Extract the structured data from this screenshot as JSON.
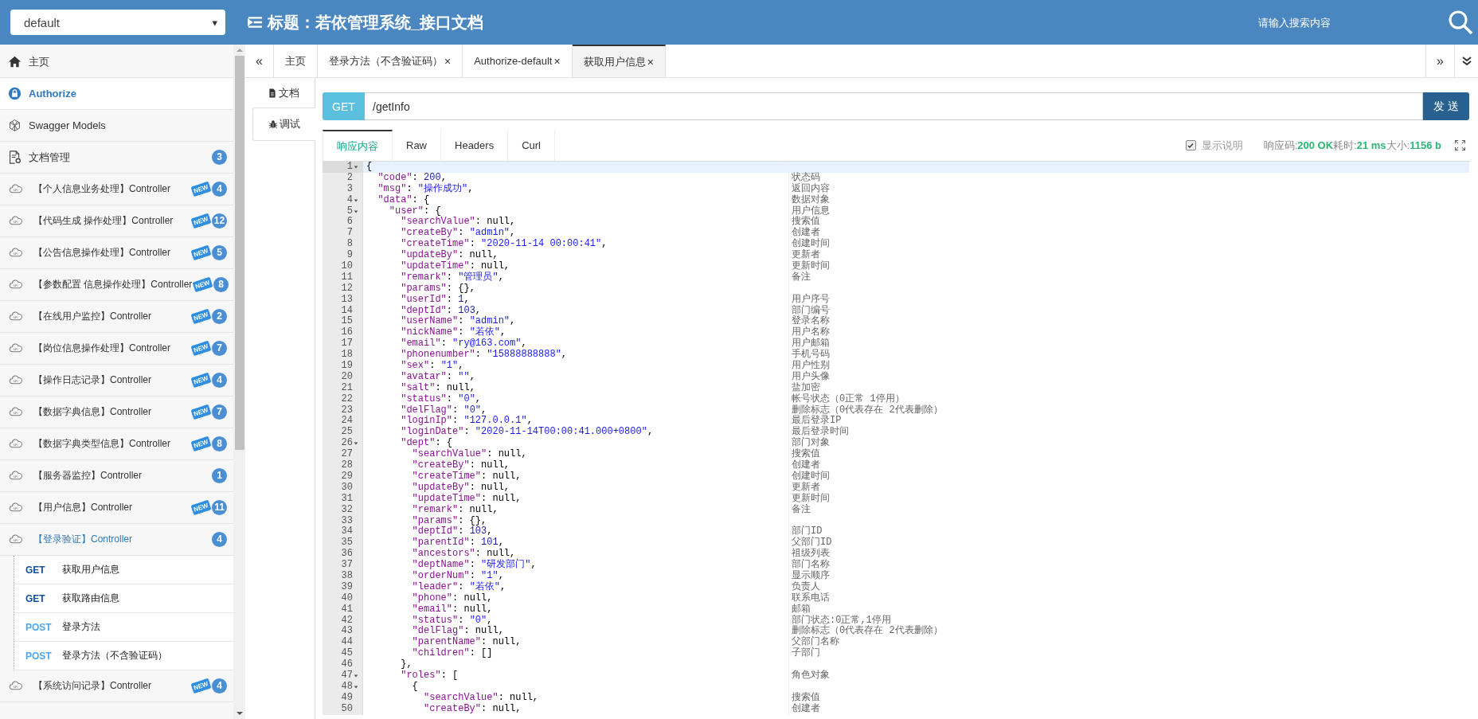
{
  "header": {
    "select": {
      "value": "default",
      "caret": "▾"
    },
    "title": "标题：若依管理系统_接口文档",
    "search": {
      "placeholder": "请输入搜索内容"
    }
  },
  "sidebar": {
    "items": [
      {
        "kind": "home",
        "label": "主页",
        "selected": false
      },
      {
        "kind": "authorize",
        "label": "Authorize",
        "selected": true
      },
      {
        "kind": "models",
        "label": "Swagger Models",
        "selected": false
      },
      {
        "kind": "docs",
        "label": "文档管理",
        "count": "3",
        "selected": false
      },
      {
        "kind": "controller",
        "label": "【个人信息业务处理】Controller",
        "new_tag": "NEW",
        "count": "4",
        "expanded": false,
        "selected": false
      },
      {
        "kind": "controller",
        "label": "【代码生成 操作处理】Controller",
        "new_tag": "NEW",
        "count": "12",
        "expanded": false,
        "selected": false
      },
      {
        "kind": "controller",
        "label": "【公告信息操作处理】Controller",
        "new_tag": "NEW",
        "count": "5",
        "expanded": false,
        "selected": false
      },
      {
        "kind": "controller",
        "label": "【参数配置 信息操作处理】Controller",
        "new_tag": "NEW",
        "count": "8",
        "expanded": false,
        "selected": false
      },
      {
        "kind": "controller",
        "label": "【在线用户监控】Controller",
        "new_tag": "NEW",
        "count": "2",
        "expanded": false,
        "selected": false
      },
      {
        "kind": "controller",
        "label": "【岗位信息操作处理】Controller",
        "new_tag": "NEW",
        "count": "7",
        "expanded": false,
        "selected": false
      },
      {
        "kind": "controller",
        "label": "【操作日志记录】Controller",
        "new_tag": "NEW",
        "count": "4",
        "expanded": false,
        "selected": false
      },
      {
        "kind": "controller",
        "label": "【数据字典信息】Controller",
        "new_tag": "NEW",
        "count": "7",
        "expanded": false,
        "selected": false
      },
      {
        "kind": "controller",
        "label": "【数据字典类型信息】Controller",
        "new_tag": "NEW",
        "count": "8",
        "expanded": false,
        "selected": false
      },
      {
        "kind": "controller",
        "label": "【服务器监控】Controller",
        "count": "1",
        "expanded": false,
        "selected": false
      },
      {
        "kind": "controller",
        "label": "【用户信息】Controller",
        "new_tag": "NEW",
        "count": "11",
        "expanded": false,
        "selected": false
      },
      {
        "kind": "controller",
        "label": "【登录验证】Controller",
        "count": "4",
        "expanded": true,
        "selected": false,
        "children": [
          {
            "kind": "get",
            "method": "GET",
            "label": "获取用户信息"
          },
          {
            "kind": "get",
            "method": "GET",
            "label": "获取路由信息"
          },
          {
            "kind": "post",
            "method": "POST",
            "label": "登录方法"
          },
          {
            "kind": "post",
            "method": "POST",
            "label": "登录方法（不含验证码）"
          }
        ]
      },
      {
        "kind": "controller",
        "label": "【系统访问记录】Controller",
        "new_tag": "NEW",
        "count": "4",
        "expanded": false,
        "selected": false
      }
    ]
  },
  "tabs": {
    "prev": "«",
    "next": "»",
    "items": [
      {
        "label": "主页",
        "selected": false
      },
      {
        "label": "登录方法（不含验证码）",
        "close": "×",
        "selected": false
      },
      {
        "label": "Authorize-default",
        "close": "×",
        "selected": false
      },
      {
        "label": "获取用户信息",
        "close": "×",
        "selected": true
      }
    ]
  },
  "side_tabs": [
    {
      "kind": "doc",
      "label": "文档",
      "selected": false
    },
    {
      "kind": "debug",
      "label": "调试",
      "selected": true
    }
  ],
  "request": {
    "method": "GET",
    "url": "/getInfo",
    "send": "发 送"
  },
  "response": {
    "tabs": [
      {
        "label": "响应内容",
        "selected": true
      },
      {
        "label": "Raw",
        "selected": false
      },
      {
        "label": "Headers",
        "selected": false
      },
      {
        "label": "Curl",
        "selected": false
      }
    ],
    "show_notes": {
      "label": "显示说明",
      "checked": true
    },
    "status": [
      {
        "label": "响应码:",
        "value": "200 OK"
      },
      {
        "label": "耗时:",
        "value": "21 ms"
      },
      {
        "label": "大小:",
        "value": "1156 b"
      }
    ],
    "lines": [
      {
        "n": "1",
        "fold": true,
        "current": true,
        "code": [
          {
            "kind": "plain",
            "text": "{"
          }
        ]
      },
      {
        "n": "2",
        "fold": false,
        "current": false,
        "code": [
          {
            "kind": "key",
            "text": "  \"code\""
          },
          {
            "kind": "plain",
            "text": ": "
          },
          {
            "kind": "number",
            "text": "200"
          },
          {
            "kind": "plain",
            "text": ","
          }
        ],
        "note": "状态码"
      },
      {
        "n": "3",
        "fold": false,
        "current": false,
        "code": [
          {
            "kind": "key",
            "text": "  \"msg\""
          },
          {
            "kind": "plain",
            "text": ": "
          },
          {
            "kind": "string",
            "text": "\"操作成功\""
          },
          {
            "kind": "plain",
            "text": ","
          }
        ],
        "note": "返回内容"
      },
      {
        "n": "4",
        "fold": true,
        "current": false,
        "code": [
          {
            "kind": "key",
            "text": "  \"data\""
          },
          {
            "kind": "plain",
            "text": ": {"
          }
        ],
        "note": "数据对象"
      },
      {
        "n": "5",
        "fold": true,
        "current": false,
        "code": [
          {
            "kind": "key",
            "text": "    \"user\""
          },
          {
            "kind": "plain",
            "text": ": {"
          }
        ],
        "note": "用户信息"
      },
      {
        "n": "6",
        "fold": false,
        "current": false,
        "code": [
          {
            "kind": "key",
            "text": "      \"searchValue\""
          },
          {
            "kind": "plain",
            "text": ": null,"
          }
        ],
        "note": "搜索值"
      },
      {
        "n": "7",
        "fold": false,
        "current": false,
        "code": [
          {
            "kind": "key",
            "text": "      \"createBy\""
          },
          {
            "kind": "plain",
            "text": ": "
          },
          {
            "kind": "string",
            "text": "\"admin\""
          },
          {
            "kind": "plain",
            "text": ","
          }
        ],
        "note": "创建者"
      },
      {
        "n": "8",
        "fold": false,
        "current": false,
        "code": [
          {
            "kind": "key",
            "text": "      \"createTime\""
          },
          {
            "kind": "plain",
            "text": ": "
          },
          {
            "kind": "string",
            "text": "\"2020-11-14 00:00:41\""
          },
          {
            "kind": "plain",
            "text": ","
          }
        ],
        "note": "创建时间"
      },
      {
        "n": "9",
        "fold": false,
        "current": false,
        "code": [
          {
            "kind": "key",
            "text": "      \"updateBy\""
          },
          {
            "kind": "plain",
            "text": ": null,"
          }
        ],
        "note": "更新者"
      },
      {
        "n": "10",
        "fold": false,
        "current": false,
        "code": [
          {
            "kind": "key",
            "text": "      \"updateTime\""
          },
          {
            "kind": "plain",
            "text": ": null,"
          }
        ],
        "note": "更新时间"
      },
      {
        "n": "11",
        "fold": false,
        "current": false,
        "code": [
          {
            "kind": "key",
            "text": "      \"remark\""
          },
          {
            "kind": "plain",
            "text": ": "
          },
          {
            "kind": "string",
            "text": "\"管理员\""
          },
          {
            "kind": "plain",
            "text": ","
          }
        ],
        "note": "备注"
      },
      {
        "n": "12",
        "fold": false,
        "current": false,
        "code": [
          {
            "kind": "key",
            "text": "      \"params\""
          },
          {
            "kind": "plain",
            "text": ": {},"
          }
        ]
      },
      {
        "n": "13",
        "fold": false,
        "current": false,
        "code": [
          {
            "kind": "key",
            "text": "      \"userId\""
          },
          {
            "kind": "plain",
            "text": ": "
          },
          {
            "kind": "number",
            "text": "1"
          },
          {
            "kind": "plain",
            "text": ","
          }
        ],
        "note": "用户序号"
      },
      {
        "n": "14",
        "fold": false,
        "current": false,
        "code": [
          {
            "kind": "key",
            "text": "      \"deptId\""
          },
          {
            "kind": "plain",
            "text": ": "
          },
          {
            "kind": "number",
            "text": "103"
          },
          {
            "kind": "plain",
            "text": ","
          }
        ],
        "note": "部门编号"
      },
      {
        "n": "15",
        "fold": false,
        "current": false,
        "code": [
          {
            "kind": "key",
            "text": "      \"userName\""
          },
          {
            "kind": "plain",
            "text": ": "
          },
          {
            "kind": "string",
            "text": "\"admin\""
          },
          {
            "kind": "plain",
            "text": ","
          }
        ],
        "note": "登录名称"
      },
      {
        "n": "16",
        "fold": false,
        "current": false,
        "code": [
          {
            "kind": "key",
            "text": "      \"nickName\""
          },
          {
            "kind": "plain",
            "text": ": "
          },
          {
            "kind": "string",
            "text": "\"若依\""
          },
          {
            "kind": "plain",
            "text": ","
          }
        ],
        "note": "用户名称"
      },
      {
        "n": "17",
        "fold": false,
        "current": false,
        "code": [
          {
            "kind": "key",
            "text": "      \"email\""
          },
          {
            "kind": "plain",
            "text": ": "
          },
          {
            "kind": "string",
            "text": "\"ry@163.com\""
          },
          {
            "kind": "plain",
            "text": ","
          }
        ],
        "note": "用户邮箱"
      },
      {
        "n": "18",
        "fold": false,
        "current": false,
        "code": [
          {
            "kind": "key",
            "text": "      \"phonenumber\""
          },
          {
            "kind": "plain",
            "text": ": "
          },
          {
            "kind": "string",
            "text": "\"15888888888\""
          },
          {
            "kind": "plain",
            "text": ","
          }
        ],
        "note": "手机号码"
      },
      {
        "n": "19",
        "fold": false,
        "current": false,
        "code": [
          {
            "kind": "key",
            "text": "      \"sex\""
          },
          {
            "kind": "plain",
            "text": ": "
          },
          {
            "kind": "string",
            "text": "\"1\""
          },
          {
            "kind": "plain",
            "text": ","
          }
        ],
        "note": "用户性别"
      },
      {
        "n": "20",
        "fold": false,
        "current": false,
        "code": [
          {
            "kind": "key",
            "text": "      \"avatar\""
          },
          {
            "kind": "plain",
            "text": ": "
          },
          {
            "kind": "string",
            "text": "\"\""
          },
          {
            "kind": "plain",
            "text": ","
          }
        ],
        "note": "用户头像"
      },
      {
        "n": "21",
        "fold": false,
        "current": false,
        "code": [
          {
            "kind": "key",
            "text": "      \"salt\""
          },
          {
            "kind": "plain",
            "text": ": null,"
          }
        ],
        "note": "盐加密"
      },
      {
        "n": "22",
        "fold": false,
        "current": false,
        "code": [
          {
            "kind": "key",
            "text": "      \"status\""
          },
          {
            "kind": "plain",
            "text": ": "
          },
          {
            "kind": "string",
            "text": "\"0\""
          },
          {
            "kind": "plain",
            "text": ","
          }
        ],
        "note": "帐号状态（0正常 1停用）"
      },
      {
        "n": "23",
        "fold": false,
        "current": false,
        "code": [
          {
            "kind": "key",
            "text": "      \"delFlag\""
          },
          {
            "kind": "plain",
            "text": ": "
          },
          {
            "kind": "string",
            "text": "\"0\""
          },
          {
            "kind": "plain",
            "text": ","
          }
        ],
        "note": "删除标志（0代表存在 2代表删除）"
      },
      {
        "n": "24",
        "fold": false,
        "current": false,
        "code": [
          {
            "kind": "key",
            "text": "      \"loginIp\""
          },
          {
            "kind": "plain",
            "text": ": "
          },
          {
            "kind": "string",
            "text": "\"127.0.0.1\""
          },
          {
            "kind": "plain",
            "text": ","
          }
        ],
        "note": "最后登录IP"
      },
      {
        "n": "25",
        "fold": false,
        "current": false,
        "code": [
          {
            "kind": "key",
            "text": "      \"loginDate\""
          },
          {
            "kind": "plain",
            "text": ": "
          },
          {
            "kind": "string",
            "text": "\"2020-11-14T00:00:41.000+0800\""
          },
          {
            "kind": "plain",
            "text": ","
          }
        ],
        "note": "最后登录时间"
      },
      {
        "n": "26",
        "fold": true,
        "current": false,
        "code": [
          {
            "kind": "key",
            "text": "      \"dept\""
          },
          {
            "kind": "plain",
            "text": ": {"
          }
        ],
        "note": "部门对象"
      },
      {
        "n": "27",
        "fold": false,
        "current": false,
        "code": [
          {
            "kind": "key",
            "text": "        \"searchValue\""
          },
          {
            "kind": "plain",
            "text": ": null,"
          }
        ],
        "note": "搜索值"
      },
      {
        "n": "28",
        "fold": false,
        "current": false,
        "code": [
          {
            "kind": "key",
            "text": "        \"createBy\""
          },
          {
            "kind": "plain",
            "text": ": null,"
          }
        ],
        "note": "创建者"
      },
      {
        "n": "29",
        "fold": false,
        "current": false,
        "code": [
          {
            "kind": "key",
            "text": "        \"createTime\""
          },
          {
            "kind": "plain",
            "text": ": null,"
          }
        ],
        "note": "创建时间"
      },
      {
        "n": "30",
        "fold": false,
        "current": false,
        "code": [
          {
            "kind": "key",
            "text": "        \"updateBy\""
          },
          {
            "kind": "plain",
            "text": ": null,"
          }
        ],
        "note": "更新者"
      },
      {
        "n": "31",
        "fold": false,
        "current": false,
        "code": [
          {
            "kind": "key",
            "text": "        \"updateTime\""
          },
          {
            "kind": "plain",
            "text": ": null,"
          }
        ],
        "note": "更新时间"
      },
      {
        "n": "32",
        "fold": false,
        "current": false,
        "code": [
          {
            "kind": "key",
            "text": "        \"remark\""
          },
          {
            "kind": "plain",
            "text": ": null,"
          }
        ],
        "note": "备注"
      },
      {
        "n": "33",
        "fold": false,
        "current": false,
        "code": [
          {
            "kind": "key",
            "text": "        \"params\""
          },
          {
            "kind": "plain",
            "text": ": {},"
          }
        ]
      },
      {
        "n": "34",
        "fold": false,
        "current": false,
        "code": [
          {
            "kind": "key",
            "text": "        \"deptId\""
          },
          {
            "kind": "plain",
            "text": ": "
          },
          {
            "kind": "number",
            "text": "103"
          },
          {
            "kind": "plain",
            "text": ","
          }
        ],
        "note": "部门ID"
      },
      {
        "n": "35",
        "fold": false,
        "current": false,
        "code": [
          {
            "kind": "key",
            "text": "        \"parentId\""
          },
          {
            "kind": "plain",
            "text": ": "
          },
          {
            "kind": "number",
            "text": "101"
          },
          {
            "kind": "plain",
            "text": ","
          }
        ],
        "note": "父部门ID"
      },
      {
        "n": "36",
        "fold": false,
        "current": false,
        "code": [
          {
            "kind": "key",
            "text": "        \"ancestors\""
          },
          {
            "kind": "plain",
            "text": ": null,"
          }
        ],
        "note": "祖级列表"
      },
      {
        "n": "37",
        "fold": false,
        "current": false,
        "code": [
          {
            "kind": "key",
            "text": "        \"deptName\""
          },
          {
            "kind": "plain",
            "text": ": "
          },
          {
            "kind": "string",
            "text": "\"研发部门\""
          },
          {
            "kind": "plain",
            "text": ","
          }
        ],
        "note": "部门名称"
      },
      {
        "n": "38",
        "fold": false,
        "current": false,
        "code": [
          {
            "kind": "key",
            "text": "        \"orderNum\""
          },
          {
            "kind": "plain",
            "text": ": "
          },
          {
            "kind": "string",
            "text": "\"1\""
          },
          {
            "kind": "plain",
            "text": ","
          }
        ],
        "note": "显示顺序"
      },
      {
        "n": "39",
        "fold": false,
        "current": false,
        "code": [
          {
            "kind": "key",
            "text": "        \"leader\""
          },
          {
            "kind": "plain",
            "text": ": "
          },
          {
            "kind": "string",
            "text": "\"若依\""
          },
          {
            "kind": "plain",
            "text": ","
          }
        ],
        "note": "负责人"
      },
      {
        "n": "40",
        "fold": false,
        "current": false,
        "code": [
          {
            "kind": "key",
            "text": "        \"phone\""
          },
          {
            "kind": "plain",
            "text": ": null,"
          }
        ],
        "note": "联系电话"
      },
      {
        "n": "41",
        "fold": false,
        "current": false,
        "code": [
          {
            "kind": "key",
            "text": "        \"email\""
          },
          {
            "kind": "plain",
            "text": ": null,"
          }
        ],
        "note": "邮箱"
      },
      {
        "n": "42",
        "fold": false,
        "current": false,
        "code": [
          {
            "kind": "key",
            "text": "        \"status\""
          },
          {
            "kind": "plain",
            "text": ": "
          },
          {
            "kind": "string",
            "text": "\"0\""
          },
          {
            "kind": "plain",
            "text": ","
          }
        ],
        "note": "部门状态:0正常,1停用"
      },
      {
        "n": "43",
        "fold": false,
        "current": false,
        "code": [
          {
            "kind": "key",
            "text": "        \"delFlag\""
          },
          {
            "kind": "plain",
            "text": ": null,"
          }
        ],
        "note": "删除标志（0代表存在 2代表删除）"
      },
      {
        "n": "44",
        "fold": false,
        "current": false,
        "code": [
          {
            "kind": "key",
            "text": "        \"parentName\""
          },
          {
            "kind": "plain",
            "text": ": null,"
          }
        ],
        "note": "父部门名称"
      },
      {
        "n": "45",
        "fold": false,
        "current": false,
        "code": [
          {
            "kind": "key",
            "text": "        \"children\""
          },
          {
            "kind": "plain",
            "text": ": []"
          }
        ],
        "note": "子部门"
      },
      {
        "n": "46",
        "fold": false,
        "current": false,
        "code": [
          {
            "kind": "plain",
            "text": "      },"
          }
        ]
      },
      {
        "n": "47",
        "fold": true,
        "current": false,
        "code": [
          {
            "kind": "key",
            "text": "      \"roles\""
          },
          {
            "kind": "plain",
            "text": ": ["
          }
        ],
        "note": "角色对象"
      },
      {
        "n": "48",
        "fold": true,
        "current": false,
        "code": [
          {
            "kind": "plain",
            "text": "        {"
          }
        ]
      },
      {
        "n": "49",
        "fold": false,
        "current": false,
        "code": [
          {
            "kind": "key",
            "text": "          \"searchValue\""
          },
          {
            "kind": "plain",
            "text": ": null,"
          }
        ],
        "note": "搜索值"
      },
      {
        "n": "50",
        "fold": false,
        "current": false,
        "code": [
          {
            "kind": "key",
            "text": "          \"createBy\""
          },
          {
            "kind": "plain",
            "text": ": null,"
          }
        ],
        "note": "创建者"
      }
    ]
  }
}
